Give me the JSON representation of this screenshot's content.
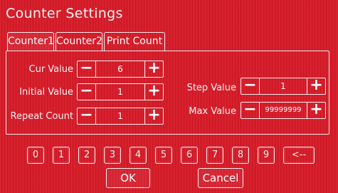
{
  "title": "Counter Settings",
  "tabs": [
    {
      "label": "Counter1"
    },
    {
      "label": "Counter2"
    },
    {
      "label": "Print Count"
    }
  ],
  "fields": {
    "cur_value": {
      "label": "Cur Value",
      "value": "6"
    },
    "initial_value": {
      "label": "Initial Value",
      "value": "1"
    },
    "repeat_count": {
      "label": "Repeat Count",
      "value": "1"
    },
    "step_value": {
      "label": "Step Value",
      "value": "1"
    },
    "max_value": {
      "label": "Max Value",
      "value": "99999999"
    }
  },
  "stepper": {
    "minus": "−",
    "plus": "+"
  },
  "keypad": [
    "0",
    "1",
    "2",
    "3",
    "4",
    "5",
    "6",
    "7",
    "8",
    "9",
    "<--"
  ],
  "actions": {
    "ok": "OK",
    "cancel": "Cancel"
  },
  "colors": {
    "background": "#d81a28",
    "border": "#eeeeee",
    "text": "#ffffff"
  }
}
